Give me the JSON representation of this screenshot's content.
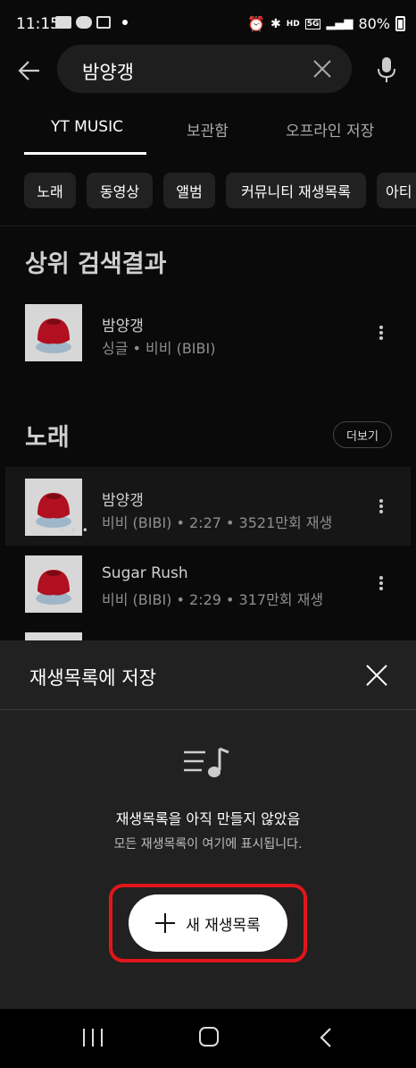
{
  "status_bar": {
    "time": "11:15",
    "battery": "80%",
    "signal_labels": [
      "HD",
      "5G"
    ]
  },
  "search": {
    "query": "밤양갱"
  },
  "tabs": [
    {
      "label": "YT MUSIC",
      "active": true
    },
    {
      "label": "보관함",
      "active": false
    },
    {
      "label": "오프라인 저장",
      "active": false
    }
  ],
  "chips": [
    "노래",
    "동영상",
    "앨범",
    "커뮤니티 재생목록",
    "아티"
  ],
  "top_result": {
    "section_title": "상위 검색결과",
    "title": "밤양갱",
    "subtitle": "싱글 • 비비 (BIBI)"
  },
  "songs": {
    "section_title": "노래",
    "more_label": "더보기",
    "items": [
      {
        "title": "밤양갱",
        "subtitle": "비비 (BIBI) • 2:27 • 3521만회 재생"
      },
      {
        "title": "Sugar Rush",
        "subtitle": "비비 (BIBI) • 2:29 • 317만회 재생"
      }
    ]
  },
  "sheet": {
    "title": "재생목록에 저장",
    "empty_title": "재생목록을 아직 만들지 않았음",
    "empty_subtitle": "모든 재생목록이 여기에 표시됩니다.",
    "new_playlist_label": "새 재생목록",
    "highlight_color": "#e0161b"
  },
  "icons": {
    "back": "arrow-left-icon",
    "clear": "close-icon",
    "mic": "microphone-icon",
    "more": "more-vert-icon",
    "playlist": "playlist-music-icon",
    "plus": "plus-icon"
  }
}
